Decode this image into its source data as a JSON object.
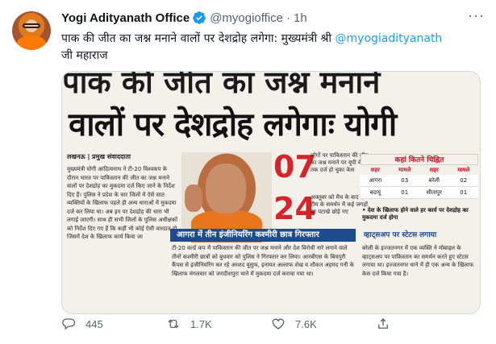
{
  "tweet": {
    "author_name": "Yogi Adityanath Office",
    "handle": "@myogioffice",
    "separator": "·",
    "time": "1h",
    "text_before_mention": "पाक की जीत का जश्न मनाने वालों पर देशद्रोह लगेगा: मुख्यमंत्री श्री ",
    "mention": "@myogiadityanath",
    "text_after_mention": "जी महाराज",
    "more_label": "···"
  },
  "newspaper": {
    "headline_top_partial": "पाक की जीत का जश्न मनाने",
    "headline": "वालों पर देशद्रोह लगेगाः योगी",
    "byline": "लखनऊ | प्रमुख संवाददाता",
    "left_text": "मुख्यमंत्री योगी आदित्यनाथ ने टी-20 विश्वकप के दौरान भारत पर पाकिस्तान की जीत का जश्न मनाने वालों पर देशद्रोह का मुकदमा दर्ज किए जाने के निर्देश दिए हैं। पुलिस ने प्रदेश के चार जिलों में ऐसे सात व्यक्तियों के खिलाफ पहले ही अन्य धाराओं में मुकदमा दर्ज कर लिया था। अब इन पर देशद्रोह की धारा भी लगाई जाएगी। साथ ही सभी जिलों के पुलिस अधीक्षकों को निर्देश दिए गए हैं कि कहीं भी कोई ऐसी वारदात हो जिसमें देश के खिलाफ कार्य किया जा",
    "stat1_number": "07",
    "stat1_note": "लोगों पर पाकिस्तान की जीत का जश्न मनाने पर यूपी में अब तक दर्ज हो चुका केस",
    "stat2_number": "24",
    "stat2_note": "अक्तूबर को मैच के बाद एक टीम के समर्थन में कई जगहों पर पटाखे छोड़े गए",
    "table_title": "कहां कितने चिह्नित",
    "table_headers": [
      "शहर",
      "मामले",
      "शहर",
      "मामले"
    ],
    "table_rows": [
      [
        "आगरा",
        "03",
        "बरेली",
        "02"
      ],
      [
        "बदायूं",
        "01",
        "सीतापुर",
        "01"
      ]
    ],
    "side_note": "• देश के खिलाफ होने वाले हर कार्य पर देशद्रोह का मुकदमा दर्ज होगा",
    "band_headline": "आगरा में तीन इंजीनियरिंग कश्मीरी छात्र गिरफ्तार",
    "band_body": "टी-20 वर्ल्ड कप में पाकिस्तान की जीत पर जश्न मनाने और देश विरोधी नारे लगाने वाले तीनों कश्मीरी छात्रों को बुधवार को पुलिस ने गिरफ्तार कर लिया। आरबीएस के बिचपुरी कैंपस से इंजीनियरिंग कर रहे अरशद यूसुफ, इनायत अल्ताफ शेख व शौकत अहमद गनी के खिलाफ मंगलवार को जगदीशपुरा थाने में मुकदमा दर्ज कराया गया था।",
    "band2_headline": "व्हाट्सअप पर स्टेटस लगाया",
    "band2_body": "बरेली के इज्जतनगर में एक व्यक्ति ने मोबाइल के व्हाट्सअप पर पाकिस्तान का समर्थन करते हुए स्टेटस लगाया था। इज्जतनगर थाने में ही एक अन्य के खिलाफ केस दर्ज किया गया है।"
  },
  "actions": {
    "replies": "445",
    "retweets": "1.7K",
    "likes": "7.6K"
  },
  "colors": {
    "link": "#1d9bf0",
    "muted": "#536471",
    "verified": "#1d9bf0",
    "headline_red": "#d4262a"
  }
}
